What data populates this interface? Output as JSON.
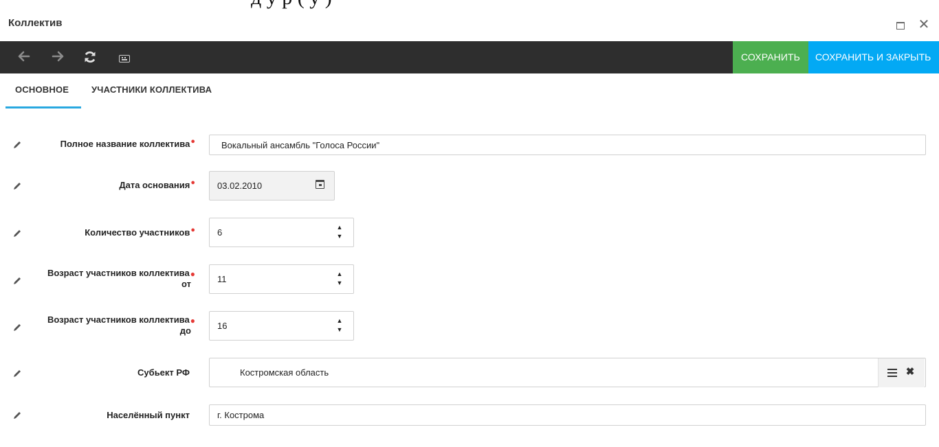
{
  "caption": {
    "text": "д                                                         у  р  (  у  )"
  },
  "window": {
    "title": "Коллектив",
    "maximize_icon": "maximize-icon",
    "close_icon": "close-icon",
    "close_glyph": "✕"
  },
  "toolbar": {
    "back_glyph": "🡐",
    "forward_glyph": "🡒",
    "refresh_glyph": "⟳",
    "save_label": "СОХРАНИТЬ",
    "save_close_label": "СОХРАНИТЬ И ЗАКРЫТЬ",
    "colors": {
      "background": "#2e2e2e",
      "save": "#4caf50",
      "save_close": "#03a9f4"
    }
  },
  "tabs": [
    {
      "label": "ОСНОВНОЕ",
      "active": true
    },
    {
      "label": "УЧАСТНИКИ КОЛЛЕКТИВА",
      "active": false
    }
  ],
  "form": {
    "full_name": {
      "label": "Полное название коллектива",
      "value": "Вокальный ансамбль \"Голоса России\"",
      "required": true
    },
    "founded": {
      "label": "Дата основания",
      "value": "03.02.2010",
      "required": true
    },
    "members_count": {
      "label": "Количество участников",
      "value": "6",
      "required": true
    },
    "age_from": {
      "label_line1": "Возраст участников коллектива",
      "label_line2": "от",
      "value": "11",
      "required": true
    },
    "age_to": {
      "label_line1": "Возраст участников коллектива",
      "label_line2": "до",
      "value": "16",
      "required": true
    },
    "region": {
      "label": "Субьект РФ",
      "value": "Костромская область"
    },
    "locality": {
      "label": "Населённый пункт",
      "value": "г. Кострома"
    }
  },
  "icons": {
    "edit": "pencil-icon",
    "pencil_glyph": "✎",
    "calendar": "calendar-icon",
    "spinner_up": "▲",
    "spinner_down": "▼",
    "select_menu": "menu-icon",
    "select_clear": "✖",
    "required_mark": "●"
  },
  "colors": {
    "accent": "#29a8e0",
    "required": "#e53935"
  }
}
